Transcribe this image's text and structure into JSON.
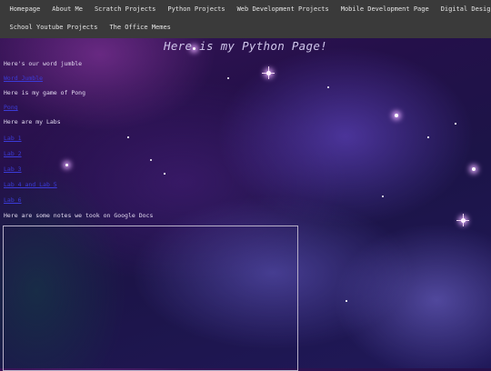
{
  "nav": {
    "row1": [
      "Homepage",
      "About Me",
      "Scratch Projects",
      "Python Projects",
      "Web Development Projects",
      "Mobile Development Page",
      "Digital Design"
    ],
    "row2": [
      "School Youtube Projects",
      "The Office Memes"
    ]
  },
  "page": {
    "title": "Here is my Python Page!"
  },
  "content": {
    "word_jumble_intro": "Here's our word jumble",
    "word_jumble_link": "Word Jumble",
    "pong_intro": "Here is my game of Pong",
    "pong_link": "Pong",
    "labs_intro": "Here are my Labs",
    "labs": [
      "Lab 1",
      "Lab 2",
      "Lab 3",
      "Lab 4 and Lab 5",
      "Lab 6"
    ],
    "notes_intro": "Here are some notes we took on Google Docs"
  }
}
